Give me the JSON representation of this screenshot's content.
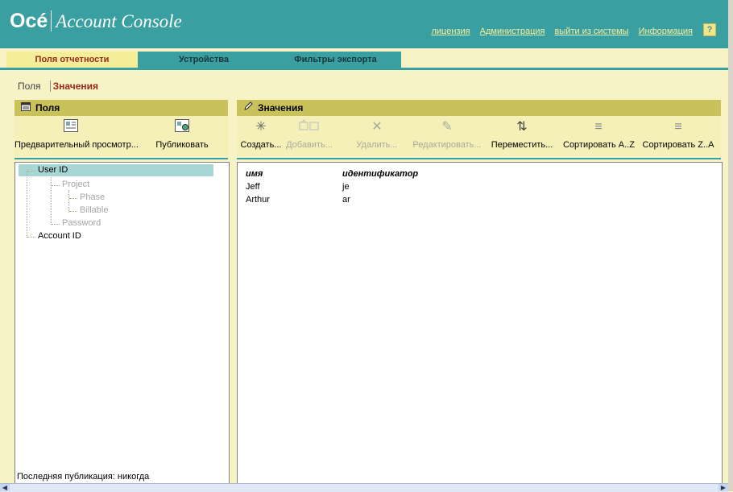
{
  "header": {
    "brand": "Océ",
    "product": "Account Console",
    "links": [
      "лицензия",
      "Администрация",
      "выйти из системы",
      "Информация"
    ],
    "help_glyph": "?"
  },
  "tabs": [
    {
      "label": "Поля отчетности",
      "active": true
    },
    {
      "label": "Устройства",
      "active": false
    },
    {
      "label": "Фильтры экспорта",
      "active": false
    }
  ],
  "subtabs": [
    {
      "label": "Поля",
      "active": false
    },
    {
      "label": "Значения",
      "active": true
    }
  ],
  "left_panel": {
    "title": "Поля",
    "tools": [
      {
        "label": "Предварительный просмотр...",
        "icon": "preview-icon"
      },
      {
        "label": "Публиковать",
        "icon": "publish-icon"
      }
    ],
    "tree": [
      {
        "label": "User ID",
        "selected": true,
        "enabled": true
      },
      {
        "label": "Project",
        "enabled": false
      },
      {
        "label": "Phase",
        "enabled": false
      },
      {
        "label": "Billable",
        "enabled": false
      },
      {
        "label": "Password",
        "enabled": false
      },
      {
        "label": "Account ID",
        "enabled": true
      }
    ],
    "last_published": "Последняя публикация: никогда"
  },
  "right_panel": {
    "title": "Значения",
    "tools": [
      {
        "label": "Создать...",
        "icon": "create-icon",
        "enabled": true
      },
      {
        "label": "Добавить...",
        "icon": "add-icon",
        "enabled": false
      },
      {
        "label": "Удалить...",
        "icon": "delete-icon",
        "enabled": false
      },
      {
        "label": "Редактировать...",
        "icon": "edit-icon",
        "enabled": false
      },
      {
        "label": "Переместить...",
        "icon": "move-icon",
        "enabled": true
      },
      {
        "label": "Сортировать A..Z",
        "icon": "sort-asc-icon",
        "enabled": true
      },
      {
        "label": "Сортировать Z..A",
        "icon": "sort-desc-icon",
        "enabled": true
      }
    ],
    "columns": [
      "имя",
      "идентификатор"
    ],
    "rows": [
      [
        "Jeff",
        "je"
      ],
      [
        "Arthur",
        "ar"
      ]
    ]
  },
  "colors": {
    "header_bg": "#3a9fa1",
    "page_bg": "#f7f3c6",
    "panel_bar": "#c9c25a",
    "active_tab_text": "#9a2a18",
    "selection": "#a7d6d5"
  }
}
